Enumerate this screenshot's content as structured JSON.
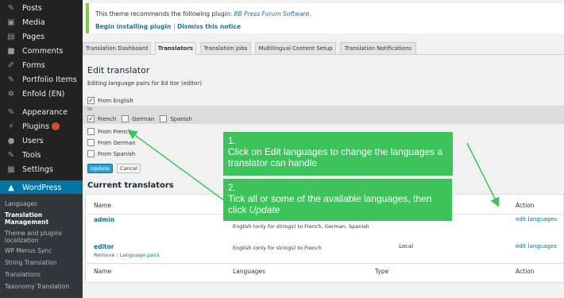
{
  "sidebar": {
    "items": [
      {
        "label": "Posts",
        "icon": "pin-icon"
      },
      {
        "label": "Media",
        "icon": "media-icon"
      },
      {
        "label": "Pages",
        "icon": "pages-icon"
      },
      {
        "label": "Comments",
        "icon": "comments-icon"
      },
      {
        "label": "Forms",
        "icon": "forms-icon"
      },
      {
        "label": "Portfolio Items",
        "icon": "pin-icon"
      },
      {
        "label": "Enfold (EN)",
        "icon": "gear-icon"
      },
      {
        "label": "Appearance",
        "icon": "brush-icon"
      },
      {
        "label": "Plugins",
        "icon": "plug-icon"
      },
      {
        "label": "Users",
        "icon": "user-icon"
      },
      {
        "label": "Tools",
        "icon": "wrench-icon"
      },
      {
        "label": "Settings",
        "icon": "settings-icon"
      },
      {
        "label": "WordPress",
        "icon": "wpml-icon"
      }
    ],
    "submenu": [
      "Languages",
      "Translation Management",
      "Theme and plugins localization",
      "WP Menus Sync",
      "String Translation",
      "Translations",
      "Taxonomy Translation"
    ]
  },
  "notice": {
    "text": "This theme recommends the following plugin: ",
    "plugin": "BB Press Forum Software.",
    "begin_link": "Begin installing plugin",
    "separator": "|",
    "dismiss_link": "Dismiss this notice"
  },
  "tabs": [
    "Translation Dashboard",
    "Translators",
    "Translation Jobs",
    "Multilingual Content Setup",
    "Translation Notifications"
  ],
  "edit": {
    "heading": "Edit translator",
    "editing_line": "Editing language pairs for Ed Itor (editor)",
    "from_english": "From English",
    "to_label": "to",
    "to_langs": [
      "French",
      "German",
      "Spanish"
    ],
    "from_french": "From French",
    "from_german": "From German",
    "from_spanish": "From Spanish",
    "update": "Update",
    "cancel": "Cancel"
  },
  "current": {
    "heading": "Current translators",
    "columns": [
      "Name",
      "Languages",
      "Type",
      "Action"
    ],
    "rows": [
      {
        "name": "admin",
        "languages": "English (only for strings) to French, German, Spanish",
        "type": "",
        "action": "edit languages"
      },
      {
        "name": "editor",
        "sub": "Remove",
        "sub_sep": "|",
        "sub2": "Language pairs",
        "languages": "English (only for strings) to French",
        "type": "Local",
        "action": "edit languages"
      }
    ]
  },
  "callouts": {
    "c1": {
      "num": "1.",
      "text": "Click on Edit languages to change the languages a translator can handle"
    },
    "c2": {
      "num": "2.",
      "text": "Tick all or some of the available languages, then click ",
      "em": "Update"
    }
  },
  "colors": {
    "accent": "#0074a2",
    "callout": "#3cc45a",
    "sidebar": "#222222"
  }
}
